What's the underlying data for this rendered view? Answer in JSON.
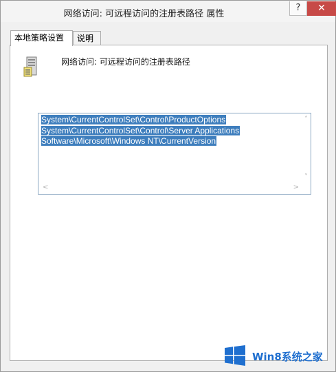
{
  "window": {
    "title": "网络访问: 可远程访问的注册表路径 属性",
    "help_label": "?",
    "close_label": "✕"
  },
  "tabs": [
    {
      "label": "本地策略设置",
      "active": true
    },
    {
      "label": "说明",
      "active": false
    }
  ],
  "policy": {
    "name": "网络访问: 可远程访问的注册表路径",
    "icon": "server-icon"
  },
  "paths": [
    "System\\CurrentControlSet\\Control\\ProductOptions",
    "System\\CurrentControlSet\\Control\\Server Applications",
    "Software\\Microsoft\\Windows NT\\CurrentVersion"
  ],
  "scroll_arrows": {
    "up": "˄",
    "down": "˅",
    "left": "<",
    "right": ">"
  },
  "watermark": {
    "text": "Win8系统之家",
    "color": "#1f6fcf"
  },
  "colors": {
    "selection": "#3e7ebd",
    "close_button": "#c74a47"
  }
}
